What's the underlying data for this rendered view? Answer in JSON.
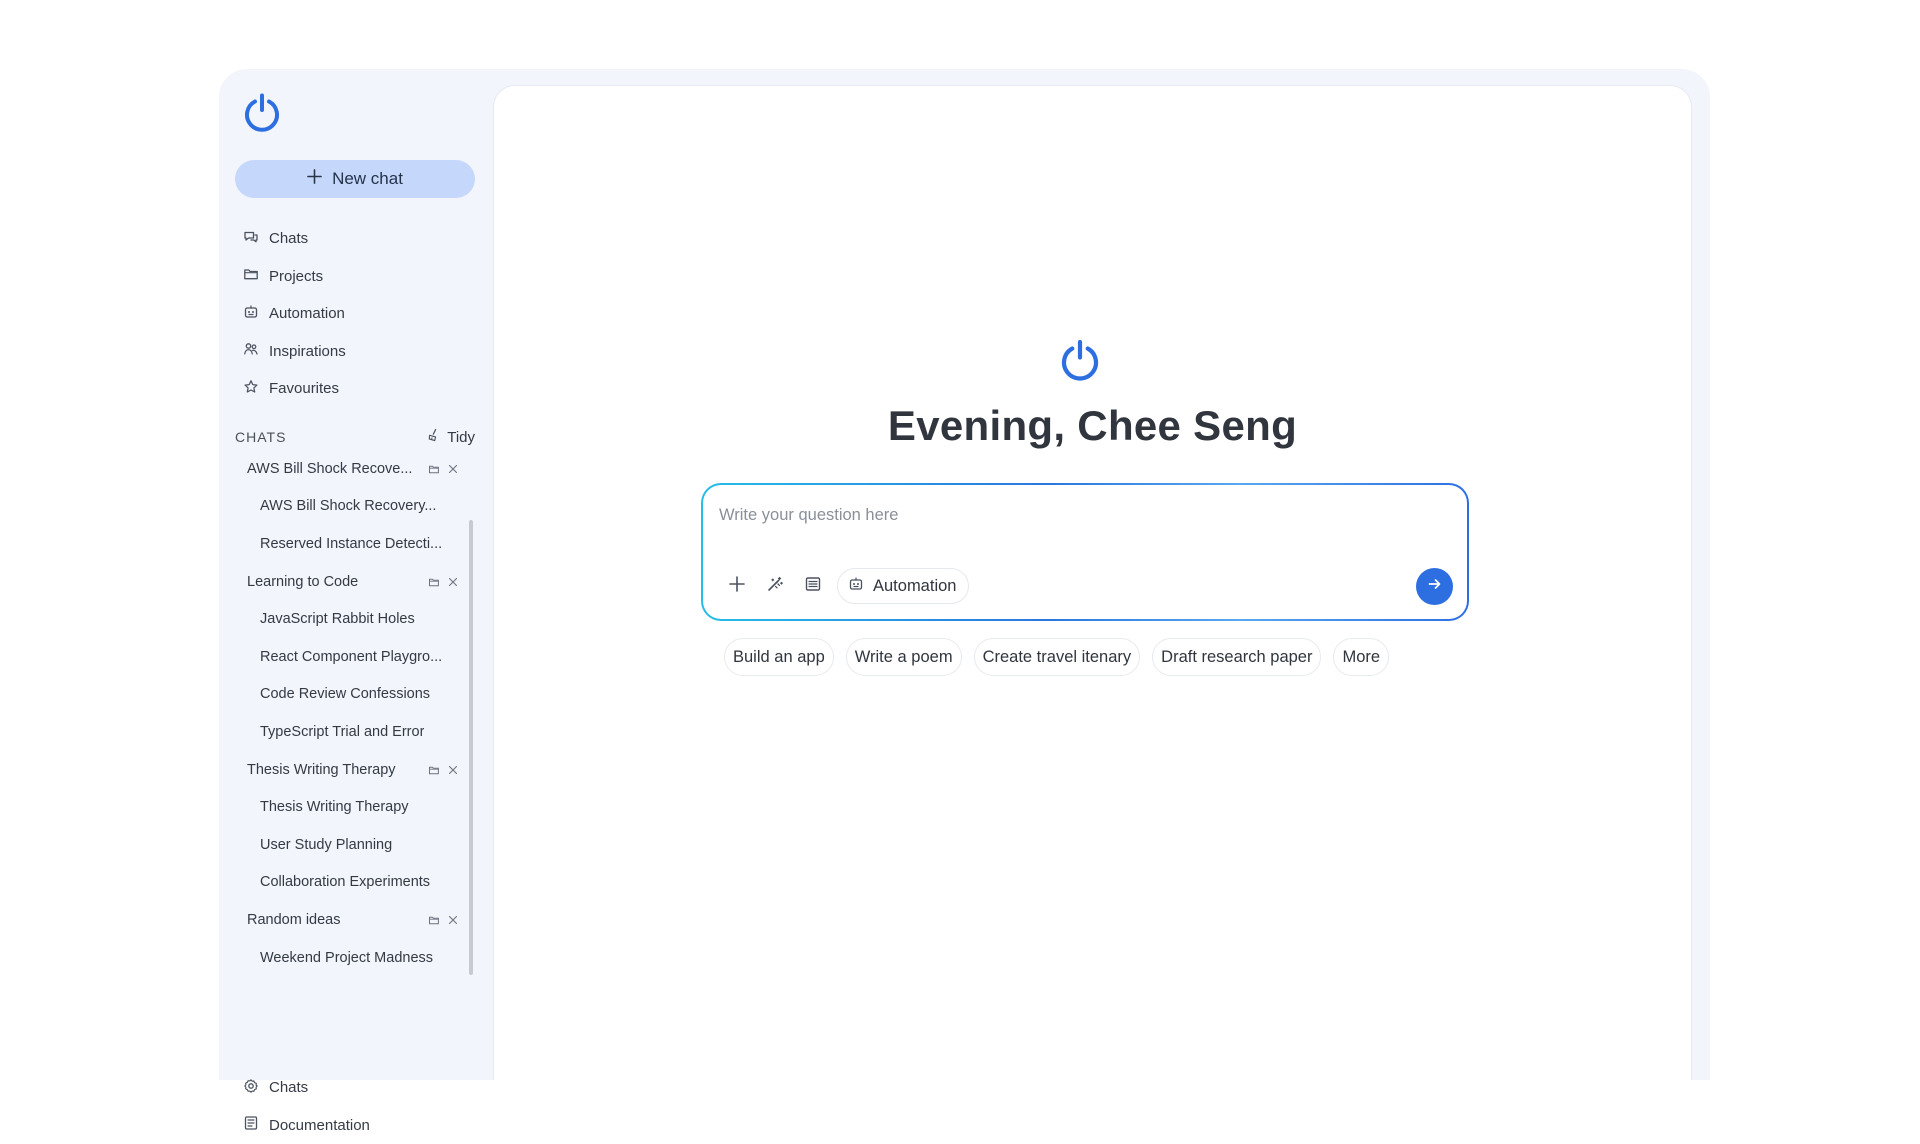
{
  "sidebar": {
    "new_chat_label": "New chat",
    "nav": [
      {
        "label": "Chats",
        "icon": "chat-bubbles-icon"
      },
      {
        "label": "Projects",
        "icon": "folder-icon"
      },
      {
        "label": "Automation",
        "icon": "robot-icon"
      },
      {
        "label": "Inspirations",
        "icon": "people-icon"
      },
      {
        "label": "Favourites",
        "icon": "star-icon"
      }
    ],
    "chats_heading": "CHATS",
    "tidy_label": "Tidy",
    "chat_rows": [
      {
        "label": "AWS Bill Shock Recove...",
        "level": "group",
        "actions": [
          "archive-icon",
          "close-icon"
        ]
      },
      {
        "label": "AWS Bill Shock Recovery...",
        "level": "child"
      },
      {
        "label": "Reserved Instance Detecti...",
        "level": "child"
      },
      {
        "label": "Learning to Code",
        "level": "group",
        "actions": [
          "archive-icon",
          "close-icon"
        ]
      },
      {
        "label": "JavaScript Rabbit Holes",
        "level": "child"
      },
      {
        "label": "React Component Playgro...",
        "level": "child"
      },
      {
        "label": "Code Review Confessions",
        "level": "child"
      },
      {
        "label": "TypeScript Trial and Error",
        "level": "child"
      },
      {
        "label": "Thesis Writing Therapy",
        "level": "group",
        "actions": [
          "archive-icon",
          "close-icon"
        ]
      },
      {
        "label": "Thesis Writing Therapy",
        "level": "child"
      },
      {
        "label": "User Study Planning",
        "level": "child"
      },
      {
        "label": "Collaboration Experiments",
        "level": "child"
      },
      {
        "label": "Random ideas",
        "level": "group",
        "actions": [
          "archive-icon",
          "close-icon"
        ]
      },
      {
        "label": "Weekend Project Madness",
        "level": "child"
      }
    ],
    "bottom": [
      {
        "label": "Chats",
        "icon": "gear-icon"
      },
      {
        "label": "Documentation",
        "icon": "document-icon"
      }
    ]
  },
  "main": {
    "greeting": "Evening, Chee Seng",
    "composer": {
      "placeholder": "Write your question here",
      "value": "",
      "tools": [
        "plus-icon",
        "magic-wand-icon",
        "document-icon"
      ],
      "automation_label": "Automation"
    },
    "suggestions": [
      "Build an app",
      "Write a poem",
      "Create travel itenary",
      "Draft research paper",
      "More"
    ]
  },
  "colors": {
    "brand_blue": "#2d6fe0",
    "sidebar_bg": "#f2f5fb",
    "new_chat_bg": "#c5d8fb",
    "text_primary": "#30353e"
  }
}
